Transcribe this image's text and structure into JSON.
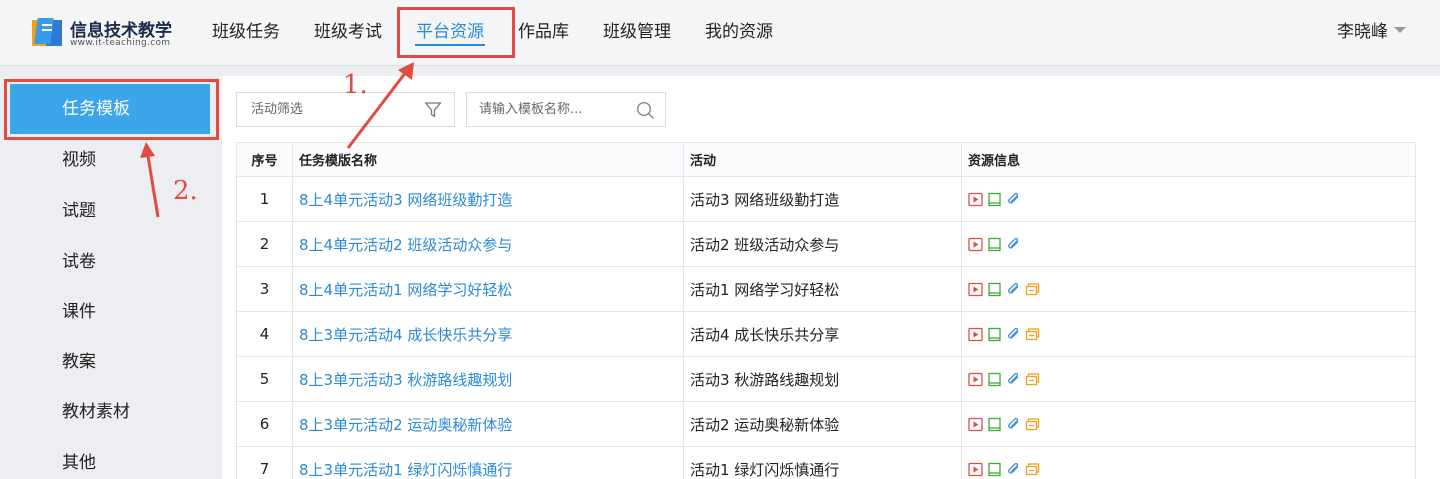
{
  "logo": {
    "title": "信息技术教学",
    "subtitle": "www.it-teaching.com"
  },
  "nav": [
    {
      "label": "班级任务",
      "active": false
    },
    {
      "label": "班级考试",
      "active": false
    },
    {
      "label": "平台资源",
      "active": true
    },
    {
      "label": "作品库",
      "active": false
    },
    {
      "label": "班级管理",
      "active": false
    },
    {
      "label": "我的资源",
      "active": false
    }
  ],
  "user": {
    "name": "李晓峰"
  },
  "annotations": {
    "one": "1.",
    "two": "2."
  },
  "sidebar": {
    "items": [
      {
        "label": "任务模板",
        "active": true
      },
      {
        "label": "视频"
      },
      {
        "label": "试题"
      },
      {
        "label": "试卷"
      },
      {
        "label": "课件"
      },
      {
        "label": "教案"
      },
      {
        "label": "教材素材"
      },
      {
        "label": "其他"
      }
    ]
  },
  "filter": {
    "label": "活动筛选"
  },
  "search": {
    "placeholder": "请输入模板名称..."
  },
  "table": {
    "headers": {
      "seq": "序号",
      "name": "任务模版名称",
      "activity": "活动",
      "resources": "资源信息"
    },
    "rows": [
      {
        "seq": "1",
        "name": "8上4单元活动3 网络班级勤打造",
        "activity": "活动3 网络班级勤打造",
        "resources": [
          "video-icon",
          "document-icon",
          "attachment-icon"
        ]
      },
      {
        "seq": "2",
        "name": "8上4单元活动2 班级活动众参与",
        "activity": "活动2 班级活动众参与",
        "resources": [
          "video-icon",
          "document-icon",
          "attachment-icon"
        ]
      },
      {
        "seq": "3",
        "name": "8上4单元活动1 网络学习好轻松",
        "activity": "活动1 网络学习好轻松",
        "resources": [
          "video-icon",
          "document-icon",
          "attachment-icon",
          "slides-icon"
        ]
      },
      {
        "seq": "4",
        "name": "8上3单元活动4 成长快乐共分享",
        "activity": "活动4 成长快乐共分享",
        "resources": [
          "video-icon",
          "document-icon",
          "attachment-icon",
          "slides-icon"
        ]
      },
      {
        "seq": "5",
        "name": "8上3单元活动3 秋游路线趣规划",
        "activity": "活动3 秋游路线趣规划",
        "resources": [
          "video-icon",
          "document-icon",
          "attachment-icon",
          "slides-icon"
        ]
      },
      {
        "seq": "6",
        "name": "8上3单元活动2 运动奥秘新体验",
        "activity": "活动2 运动奥秘新体验",
        "resources": [
          "video-icon",
          "document-icon",
          "attachment-icon",
          "slides-icon"
        ]
      },
      {
        "seq": "7",
        "name": "8上3单元活动1 绿灯闪烁慎通行",
        "activity": "活动1 绿灯闪烁慎通行",
        "resources": [
          "video-icon",
          "document-icon",
          "attachment-icon",
          "slides-icon"
        ]
      }
    ]
  },
  "colors": {
    "accent": "#2b8ad8",
    "sidebar_active": "#3ba5e9",
    "annotation": "#e24b42"
  }
}
